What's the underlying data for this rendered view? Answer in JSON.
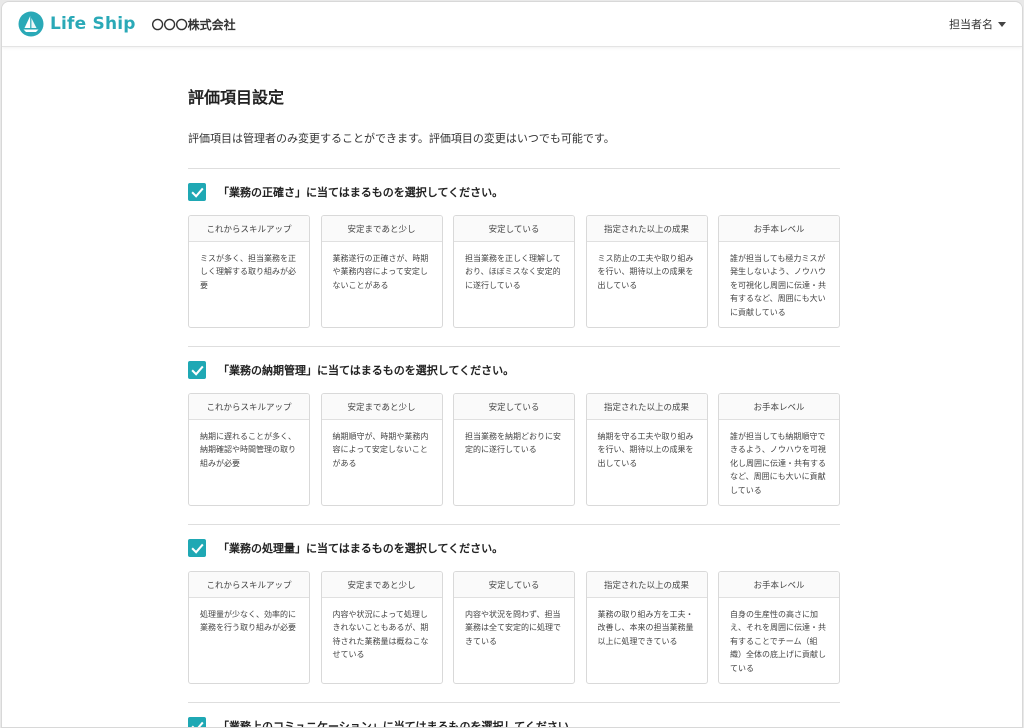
{
  "header": {
    "brand": "Life Ship",
    "company": "〇〇〇株式会社",
    "user_menu": "担当者名",
    "brand_color": "#2aa9b7"
  },
  "page": {
    "title": "評価項目設定",
    "description": "評価項目は管理者のみ変更することができます。評価項目の変更はいつでも可能です。"
  },
  "levels": [
    "これからスキルアップ",
    "安定まであと少し",
    "安定している",
    "指定された以上の成果",
    "お手本レベル"
  ],
  "sections": [
    {
      "question": "「業務の正確さ」に当てはまるものを選択してください。",
      "checked": true,
      "cards": [
        "ミスが多く、担当業務を正しく理解する取り組みが必要",
        "業務遂行の正確さが、時期や業務内容によって安定しないことがある",
        "担当業務を正しく理解しており、ほぼミスなく安定的に遂行している",
        "ミス防止の工夫や取り組みを行い、期待以上の成果を出している",
        "誰が担当しても極力ミスが発生しないよう、ノウハウを可視化し周囲に伝達・共有するなど、周囲にも大いに貢献している"
      ]
    },
    {
      "question": "「業務の納期管理」に当てはまるものを選択してください。",
      "checked": true,
      "cards": [
        "納期に遅れることが多く、納期確認や時間管理の取り組みが必要",
        "納期順守が、時期や業務内容によって安定しないことがある",
        "担当業務を納期どおりに安定的に遂行している",
        "納期を守る工夫や取り組みを行い、期待以上の成果を出している",
        "誰が担当しても納期順守できるよう、ノウハウを可視化し周囲に伝達・共有するなど、周囲にも大いに貢献している"
      ]
    },
    {
      "question": "「業務の処理量」に当てはまるものを選択してください。",
      "checked": true,
      "cards": [
        "処理量が少なく、効率的に業務を行う取り組みが必要",
        "内容や状況によって処理しきれないこともあるが、期待された業務量は概ねこなせている",
        "内容や状況を問わず、担当業務は全て安定的に処理できている",
        "業務の取り組み方を工夫・改善し、本来の担当業務量以上に処理できている",
        "自身の生産性の高さに加え、それを周囲に伝達・共有することでチーム（組織）全体の底上げに貢献している"
      ]
    },
    {
      "question": "「業務上のコミュニケーション」に当てはまるものを選択してください。",
      "checked": true
    }
  ]
}
